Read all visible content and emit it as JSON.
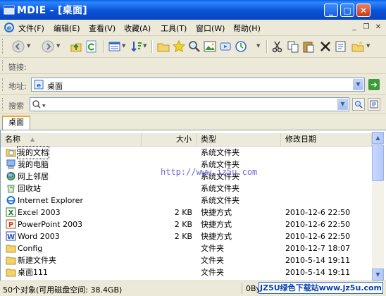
{
  "window": {
    "title": "MDIE - [桌面]"
  },
  "menu": [
    "文件(F)",
    "编辑(E)",
    "查看(V)",
    "收藏(A)",
    "工具(T)",
    "窗口(W)",
    "帮助(H)"
  ],
  "links_bar": {
    "label": "链接:"
  },
  "address_bar": {
    "label": "地址:",
    "value": "桌面"
  },
  "search_bar": {
    "label": "搜索",
    "value": ""
  },
  "tabs": [
    {
      "label": "桌面"
    }
  ],
  "columns": {
    "name": "名称",
    "size": "大小",
    "type": "类型",
    "modified": "修改日期"
  },
  "files": [
    {
      "name": "我的文档",
      "size": "",
      "type": "系统文件夹",
      "modified": "",
      "icon": "my-documents-icon"
    },
    {
      "name": "我的电脑",
      "size": "",
      "type": "系统文件夹",
      "modified": "",
      "icon": "my-computer-icon"
    },
    {
      "name": "网上邻居",
      "size": "",
      "type": "系统文件夹",
      "modified": "",
      "icon": "network-icon"
    },
    {
      "name": "回收站",
      "size": "",
      "type": "系统文件夹",
      "modified": "",
      "icon": "recycle-bin-icon"
    },
    {
      "name": "Internet Explorer",
      "size": "",
      "type": "系统文件夹",
      "modified": "",
      "icon": "internet-explorer-icon"
    },
    {
      "name": "Excel 2003",
      "size": "2 KB",
      "type": "快捷方式",
      "modified": "2010-12-6 22:50",
      "icon": "excel-icon"
    },
    {
      "name": "PowerPoint 2003",
      "size": "2 KB",
      "type": "快捷方式",
      "modified": "2010-12-6 22:50",
      "icon": "powerpoint-icon"
    },
    {
      "name": "Word 2003",
      "size": "2 KB",
      "type": "快捷方式",
      "modified": "2010-12-6 22:50",
      "icon": "word-icon"
    },
    {
      "name": "Config",
      "size": "",
      "type": "文件夹",
      "modified": "2010-12-7 18:07",
      "icon": "folder-icon"
    },
    {
      "name": "新建文件夹",
      "size": "",
      "type": "文件夹",
      "modified": "2010-5-14 19:11",
      "icon": "folder-icon"
    },
    {
      "name": "桌面111",
      "size": "",
      "type": "文件夹",
      "modified": "2010-5-14 19:11",
      "icon": "folder-icon"
    }
  ],
  "status": {
    "left": "50个对象(可用磁盘空间: 38.4GB)",
    "right": "0Bytes"
  },
  "watermark": {
    "url": "http://www.jz5u.com",
    "badge": "JZ5U绿色下载站www.jz5u.com"
  },
  "colors": {
    "title_bar": "#0a52d6",
    "tab_accent": "#f5a623",
    "selection_blue": "#316ac5"
  }
}
